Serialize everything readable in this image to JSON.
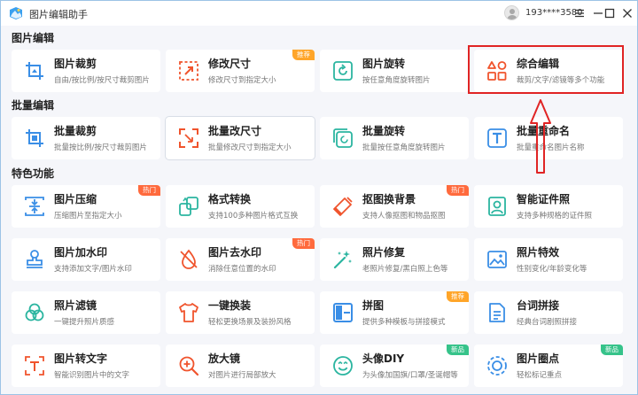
{
  "app": {
    "title": "图片编辑助手",
    "username": "193****3580"
  },
  "sections": {
    "edit": "图片编辑",
    "batch": "批量编辑",
    "features": "特色功能"
  },
  "cards": {
    "crop": {
      "name": "图片裁剪",
      "desc": "自由/按比例/按尺寸裁剪图片"
    },
    "resize": {
      "name": "修改尺寸",
      "desc": "修改尺寸到指定大小",
      "badge": "推荐"
    },
    "rotate": {
      "name": "图片旋转",
      "desc": "按任意角度旋转图片"
    },
    "combo": {
      "name": "综合编辑",
      "desc": "裁剪/文字/滤镜等多个功能"
    },
    "batch_crop": {
      "name": "批量裁剪",
      "desc": "批量按比例/按尺寸裁剪图片"
    },
    "batch_resize": {
      "name": "批量改尺寸",
      "desc": "批量修改尺寸到指定大小"
    },
    "batch_rotate": {
      "name": "批量旋转",
      "desc": "批量按任意角度旋转图片"
    },
    "batch_rename": {
      "name": "批量重命名",
      "desc": "批量重命名图片名称"
    },
    "compress": {
      "name": "图片压缩",
      "desc": "压缩图片至指定大小",
      "badge": "热门"
    },
    "convert": {
      "name": "格式转换",
      "desc": "支持100多种图片格式互换"
    },
    "cutout": {
      "name": "抠图换背景",
      "desc": "支持人像抠图和物品抠图",
      "badge": "热门"
    },
    "idphoto": {
      "name": "智能证件照",
      "desc": "支持多种规格的证件照"
    },
    "watermark_add": {
      "name": "图片加水印",
      "desc": "支持添加文字/图片水印"
    },
    "watermark_remove": {
      "name": "图片去水印",
      "desc": "消除任意位置的水印",
      "badge": "热门"
    },
    "repair": {
      "name": "照片修复",
      "desc": "老照片修复/黑白照上色等"
    },
    "effects": {
      "name": "照片特效",
      "desc": "性别变化/年龄变化等"
    },
    "filter": {
      "name": "照片滤镜",
      "desc": "一键提升照片质感"
    },
    "outfit": {
      "name": "一键换装",
      "desc": "轻松更换场景及装扮风格"
    },
    "collage": {
      "name": "拼图",
      "desc": "提供多种模板与拼接模式",
      "badge": "推荐"
    },
    "caption": {
      "name": "台词拼接",
      "desc": "经典台词剧照拼接"
    },
    "ocr": {
      "name": "图片转文字",
      "desc": "智能识别图片中的文字"
    },
    "magnify": {
      "name": "放大镜",
      "desc": "对图片进行局部放大"
    },
    "avatar_diy": {
      "name": "头像DIY",
      "desc": "为头像加国旗/口罩/圣诞帽等",
      "badge": "新品"
    },
    "circle": {
      "name": "图片圈点",
      "desc": "轻松标记重点",
      "badge": "新品"
    }
  },
  "colors": {
    "accent_orange": "#f0542d",
    "icon_blue": "#3a8ee6",
    "icon_teal": "#2bb5a0",
    "highlight_red": "#e02424",
    "badge_hot": "#ff6a3d",
    "badge_recommend": "#ffa529",
    "badge_new": "#36c38a"
  }
}
